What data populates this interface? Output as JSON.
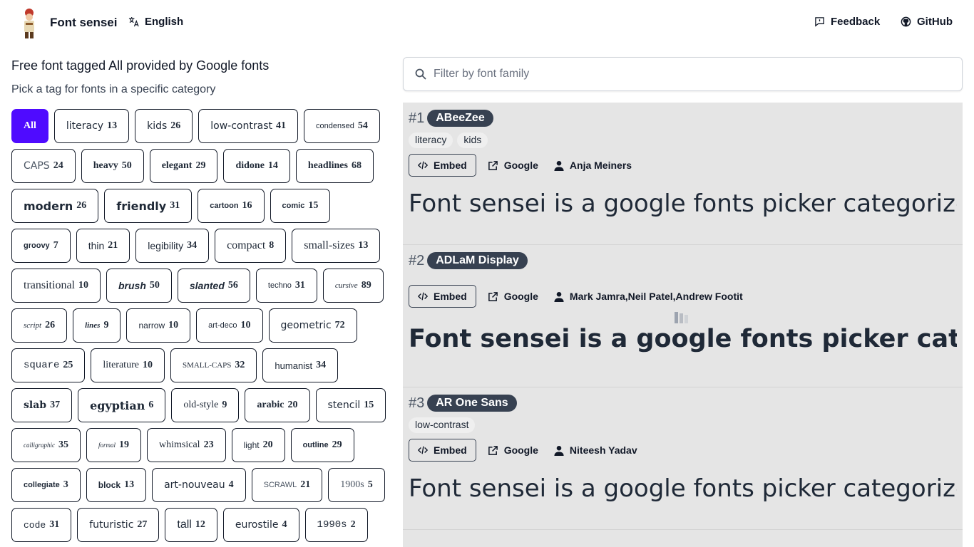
{
  "header": {
    "brand": "Font sensei",
    "language": "English",
    "feedback": "Feedback",
    "github": "GitHub"
  },
  "left": {
    "title": "Free font tagged All provided by Google fonts",
    "subtitle": "Pick a tag for fonts in a specific category",
    "active_tag": "All",
    "tags": [
      {
        "label": "literacy",
        "count": "13"
      },
      {
        "label": "kids",
        "count": "26"
      },
      {
        "label": "low-contrast",
        "count": "41"
      },
      {
        "label": "condensed",
        "count": "54"
      },
      {
        "label": "CAPS",
        "count": "24"
      },
      {
        "label": "heavy",
        "count": "50"
      },
      {
        "label": "elegant",
        "count": "29"
      },
      {
        "label": "didone",
        "count": "14"
      },
      {
        "label": "headlines",
        "count": "68"
      },
      {
        "label": "modern",
        "count": "26"
      },
      {
        "label": "friendly",
        "count": "31"
      },
      {
        "label": "cartoon",
        "count": "16"
      },
      {
        "label": "comic",
        "count": "15"
      },
      {
        "label": "groovy",
        "count": "7"
      },
      {
        "label": "thin",
        "count": "21"
      },
      {
        "label": "legibility",
        "count": "34"
      },
      {
        "label": "compact",
        "count": "8"
      },
      {
        "label": "small-sizes",
        "count": "13"
      },
      {
        "label": "transitional",
        "count": "10"
      },
      {
        "label": "brush",
        "count": "50"
      },
      {
        "label": "slanted",
        "count": "56"
      },
      {
        "label": "techno",
        "count": "31"
      },
      {
        "label": "cursive",
        "count": "89"
      },
      {
        "label": "script",
        "count": "26"
      },
      {
        "label": "lines",
        "count": "9"
      },
      {
        "label": "narrow",
        "count": "10"
      },
      {
        "label": "art-deco",
        "count": "10"
      },
      {
        "label": "geometric",
        "count": "72"
      },
      {
        "label": "square",
        "count": "25"
      },
      {
        "label": "literature",
        "count": "10"
      },
      {
        "label": "SMALL-CAPS",
        "count": "32"
      },
      {
        "label": "humanist",
        "count": "34"
      },
      {
        "label": "slab",
        "count": "37"
      },
      {
        "label": "egyptian",
        "count": "6"
      },
      {
        "label": "old-style",
        "count": "9"
      },
      {
        "label": "arabic",
        "count": "20"
      },
      {
        "label": "stencil",
        "count": "15"
      },
      {
        "label": "calligraphic",
        "count": "35"
      },
      {
        "label": "formal",
        "count": "19"
      },
      {
        "label": "whimsical",
        "count": "23"
      },
      {
        "label": "light",
        "count": "20"
      },
      {
        "label": "outline",
        "count": "29"
      },
      {
        "label": "collegiate",
        "count": "3"
      },
      {
        "label": "block",
        "count": "13"
      },
      {
        "label": "art-nouveau",
        "count": "4"
      },
      {
        "label": "SCRAWL",
        "count": "21"
      },
      {
        "label": "1900s",
        "count": "5"
      },
      {
        "label": "code",
        "count": "31"
      },
      {
        "label": "futuristic",
        "count": "27"
      },
      {
        "label": "tall",
        "count": "12"
      },
      {
        "label": "eurostile",
        "count": "4"
      },
      {
        "label": "1990s",
        "count": "2"
      }
    ]
  },
  "filter": {
    "placeholder": "Filter by font family"
  },
  "cards": [
    {
      "rank": "#1",
      "family": "ABeeZee",
      "tags": [
        "literacy",
        "kids"
      ],
      "embed": "Embed",
      "source": "Google",
      "author": "Anja Meiners",
      "sample": "Font sensei is a google fonts picker categorized by tags"
    },
    {
      "rank": "#2",
      "family": "ADLaM Display",
      "tags": [],
      "embed": "Embed",
      "source": "Google",
      "author": "Mark Jamra,Neil Patel,Andrew Footit",
      "sample": "Font sensei is a google fonts picker categorized by tags"
    },
    {
      "rank": "#3",
      "family": "AR One Sans",
      "tags": [
        "low-contrast"
      ],
      "embed": "Embed",
      "source": "Google",
      "author": "Niteesh Yadav",
      "sample": "Font sensei is a google fonts picker categorized by tags"
    }
  ],
  "colors": {
    "accent": "#4f0bff",
    "badge": "#374151",
    "list_bg": "#e5e5e5"
  }
}
